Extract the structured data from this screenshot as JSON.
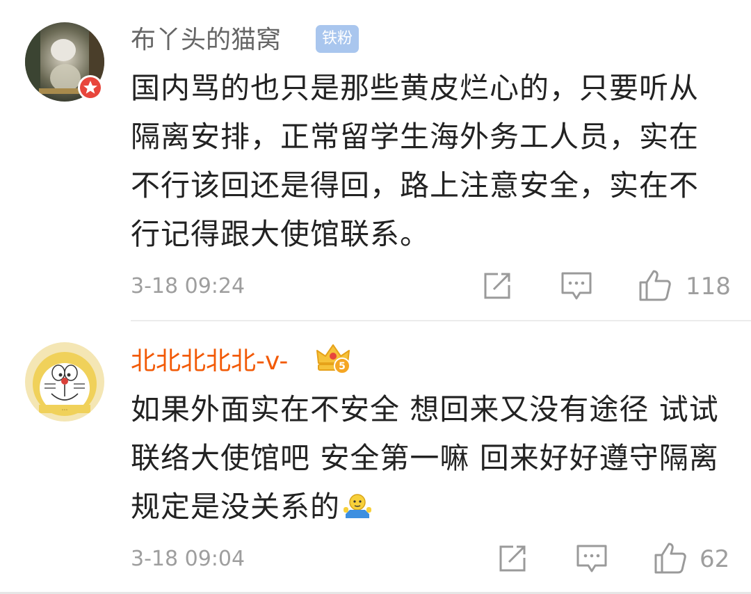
{
  "comments": [
    {
      "username": "布丫头的猫窝",
      "badge": "铁粉",
      "text": "国内骂的也只是那些黄皮烂心的，只要听从隔离安排，正常留学生海外务工人员，实在不行该回还是得回，路上注意安全，实在不行记得跟大使馆联系。",
      "time": "3-18 09:24",
      "likes": "118",
      "username_color": "#666666",
      "avatar_badge_icon": "star-verified-icon"
    },
    {
      "username": "北北北北北-v-",
      "crown_level": "5",
      "text": "如果外面实在不安全 想回来又没有途径 试试联络大使馆吧 安全第一嘛 回来好好遵守隔离规定是没关系的",
      "emoji_icon": "shrug-emoji-icon",
      "time": "3-18 09:04",
      "likes": "62",
      "username_color": "#f25a06",
      "avatar_badge_icon": "doraemon-avatar"
    }
  ],
  "icons": {
    "share": "share-icon",
    "comment": "comment-icon",
    "like": "thumbs-up-icon"
  }
}
